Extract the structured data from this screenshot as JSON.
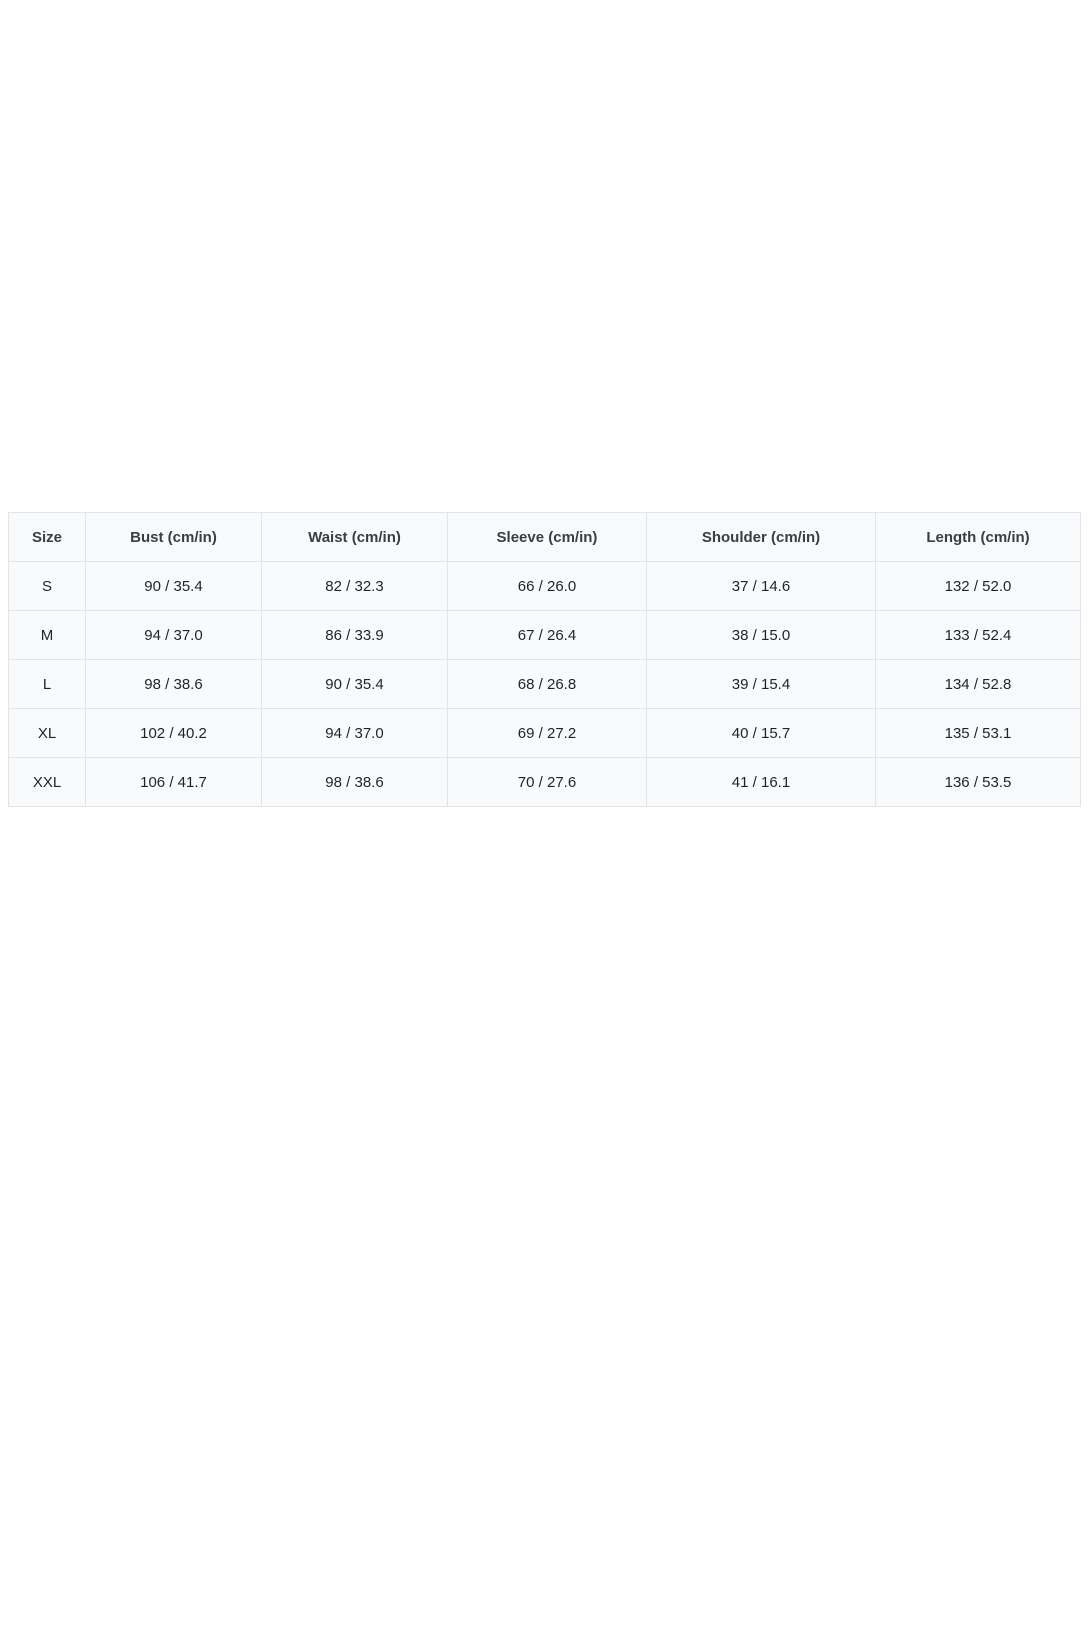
{
  "table": {
    "headers": [
      "Size",
      "Bust (cm/in)",
      "Waist (cm/in)",
      "Sleeve (cm/in)",
      "Shoulder (cm/in)",
      "Length (cm/in)"
    ],
    "rows": [
      [
        "S",
        "90 / 35.4",
        "82 / 32.3",
        "66 / 26.0",
        "37 / 14.6",
        "132 / 52.0"
      ],
      [
        "M",
        "94 / 37.0",
        "86 / 33.9",
        "67 / 26.4",
        "38 / 15.0",
        "133 / 52.4"
      ],
      [
        "L",
        "98 / 38.6",
        "90 / 35.4",
        "68 / 26.8",
        "39 / 15.4",
        "134 / 52.8"
      ],
      [
        "XL",
        "102 / 40.2",
        "94 / 37.0",
        "69 / 27.2",
        "40 / 15.7",
        "135 / 53.1"
      ],
      [
        "XXL",
        "106 / 41.7",
        "98 / 38.6",
        "70 / 27.6",
        "41 / 16.1",
        "136 / 53.5"
      ]
    ]
  },
  "colors": {
    "table_background": "#f9fafb",
    "border": "#e2e4e7",
    "text": "#1f2328"
  }
}
